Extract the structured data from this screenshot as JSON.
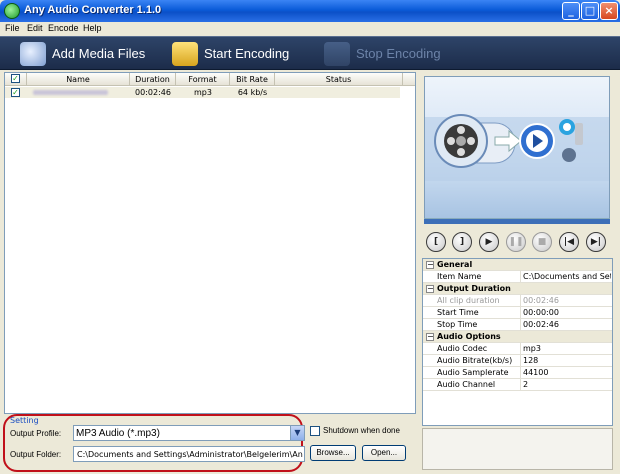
{
  "window": {
    "title": "Any Audio Converter 1.1.0"
  },
  "menu": {
    "items": [
      "File",
      "Edit",
      "Encode",
      "Help"
    ]
  },
  "toolbar": {
    "add_label": "Add Media Files",
    "start_label": "Start Encoding",
    "stop_label": "Stop Encoding"
  },
  "filelist": {
    "columns": [
      "Name",
      "Duration",
      "Format",
      "Bit Rate",
      "Status"
    ],
    "rows": [
      {
        "checked": true,
        "duration": "00:02:46",
        "format": "mp3",
        "bitrate": "64 kb/s",
        "status": ""
      }
    ]
  },
  "settings": {
    "legend": "Setting",
    "profile_label": "Output Profile:",
    "profile_value": "MP3 Audio (*.mp3)",
    "folder_label": "Output Folder:",
    "folder_value": "C:\\Documents and Settings\\Administrator\\Belgelerim\\Any Audio",
    "shutdown_label": "Shutdown when done",
    "browse_label": "Browse...",
    "open_label": "Open..."
  },
  "properties": {
    "general": {
      "title": "General",
      "item_name_key": "Item Name",
      "item_name_value": "C:\\Documents and Setti..."
    },
    "duration": {
      "title": "Output Duration",
      "all_clip_key": "All clip duration",
      "all_clip_value": "00:02:46",
      "start_key": "Start Time",
      "start_value": "00:00:00",
      "stop_key": "Stop Time",
      "stop_value": "00:02:46"
    },
    "audio": {
      "title": "Audio Options",
      "codec_key": "Audio Codec",
      "codec_value": "mp3",
      "bitrate_key": "Audio Bitrate(kb/s)",
      "bitrate_value": "128",
      "samplerate_key": "Audio Samplerate",
      "samplerate_value": "44100",
      "channel_key": "Audio Channel",
      "channel_value": "2"
    }
  },
  "colors": {
    "titlebar": "#0a5bd8",
    "toolbar": "#1c2c4a",
    "highlight_oval": "#c0101a",
    "setting_legend": "#1b4ec0"
  }
}
